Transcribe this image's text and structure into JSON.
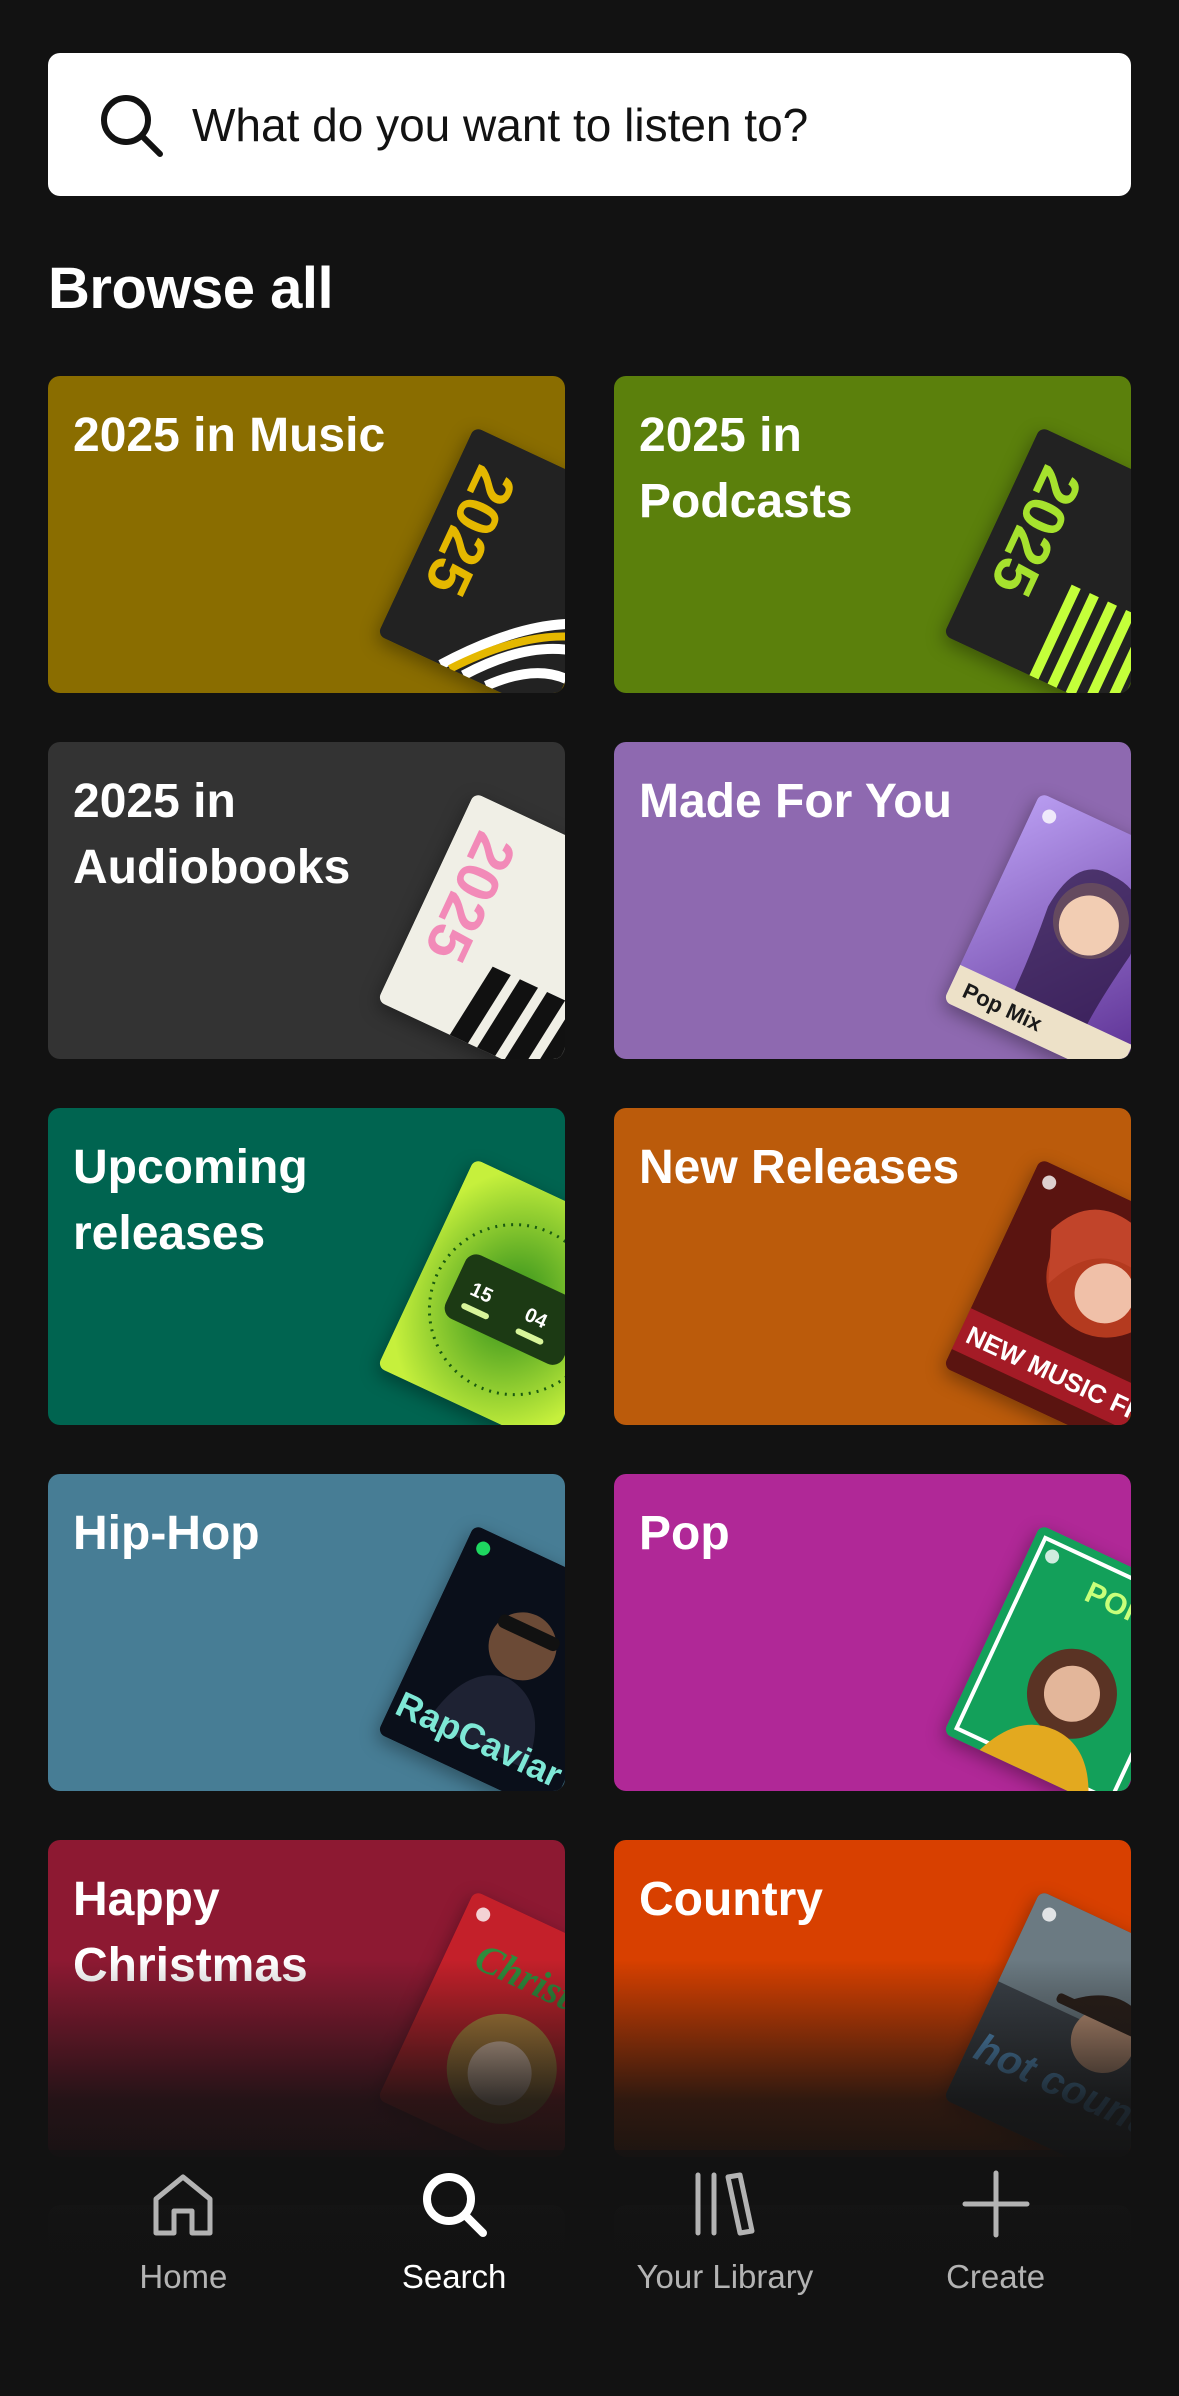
{
  "search": {
    "placeholder": "What do you want to listen to?"
  },
  "browse": {
    "title": "Browse all"
  },
  "categories": [
    {
      "label": "2025 in Music",
      "color": "#8a6d00",
      "art": "wrapped-music"
    },
    {
      "label": "2025 in Podcasts",
      "color": "#5b800c",
      "art": "wrapped-podcasts"
    },
    {
      "label": "2025 in Audiobooks",
      "color": "#333333",
      "art": "wrapped-audiobooks"
    },
    {
      "label": "Made For You",
      "color": "#8e69b0",
      "art": "pop-mix-cover",
      "art_text": "Pop Mix"
    },
    {
      "label": "Upcoming releases",
      "color": "#006450",
      "art": "countdown-cover",
      "art_text_a": "15",
      "art_text_b": "04"
    },
    {
      "label": "New Releases",
      "color": "#bb5b0b",
      "art": "new-music-friday-cover",
      "art_text": "NEW MUSIC FRIDAY"
    },
    {
      "label": "Hip-Hop",
      "color": "#477d95",
      "art": "rapcaviar-cover",
      "art_text": "RapCaviar"
    },
    {
      "label": "Pop",
      "color": "#b02897",
      "art": "pop-rising-cover",
      "art_text": "POP RISING"
    },
    {
      "label": "Happy Christmas",
      "color": "#8d1932",
      "art": "christmas-cover",
      "art_text": "Christmas"
    },
    {
      "label": "Country",
      "color": "#d84000",
      "art": "hot-country-cover",
      "art_text": "hot country"
    }
  ],
  "nav": {
    "items": [
      {
        "label": "Home",
        "icon": "home-icon",
        "active": false
      },
      {
        "label": "Search",
        "icon": "search-icon",
        "active": true
      },
      {
        "label": "Your Library",
        "icon": "library-icon",
        "active": false
      },
      {
        "label": "Create",
        "icon": "plus-icon",
        "active": false
      }
    ]
  }
}
